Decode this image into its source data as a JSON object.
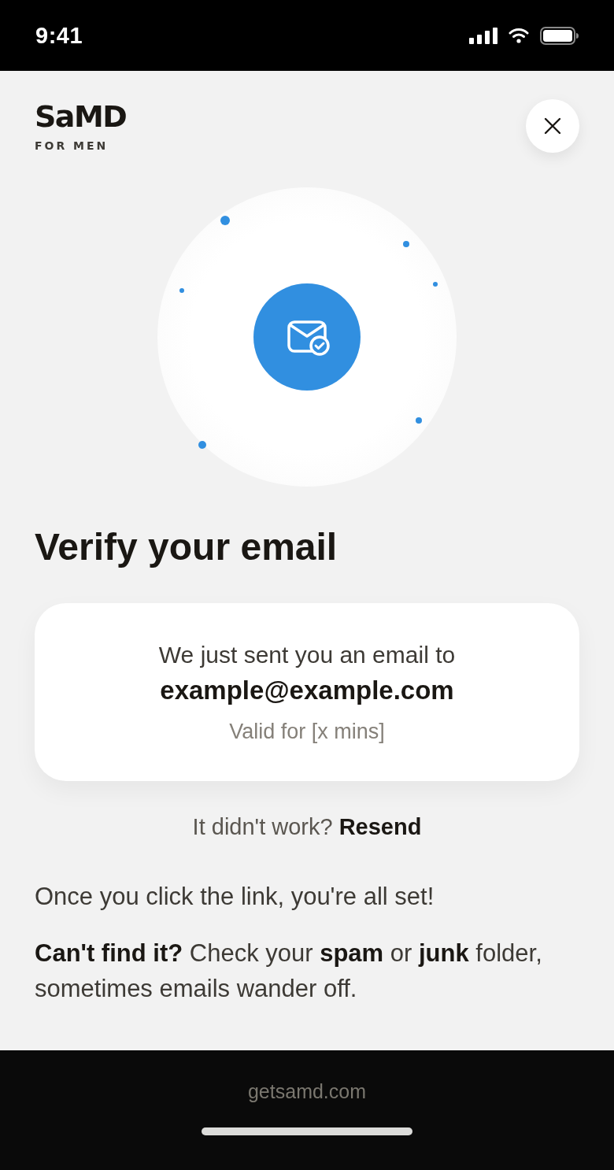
{
  "status_bar": {
    "time": "9:41"
  },
  "header": {
    "logo": {
      "wordmark": "SaMD",
      "tagline": "FOR MEN"
    }
  },
  "title": "Verify your email",
  "card": {
    "intro": "We just sent you an email to",
    "email": "example@example.com",
    "validity": "Valid for [x mins]"
  },
  "resend": {
    "prompt": "It didn't work?",
    "link": "Resend"
  },
  "notes": [
    "Once you click the link, you're all set!",
    "**Can't find it?** Check your **spam** or **junk** folder, sometimes emails wander off."
  ],
  "browser_bar": {
    "url": "getsamd.com"
  }
}
